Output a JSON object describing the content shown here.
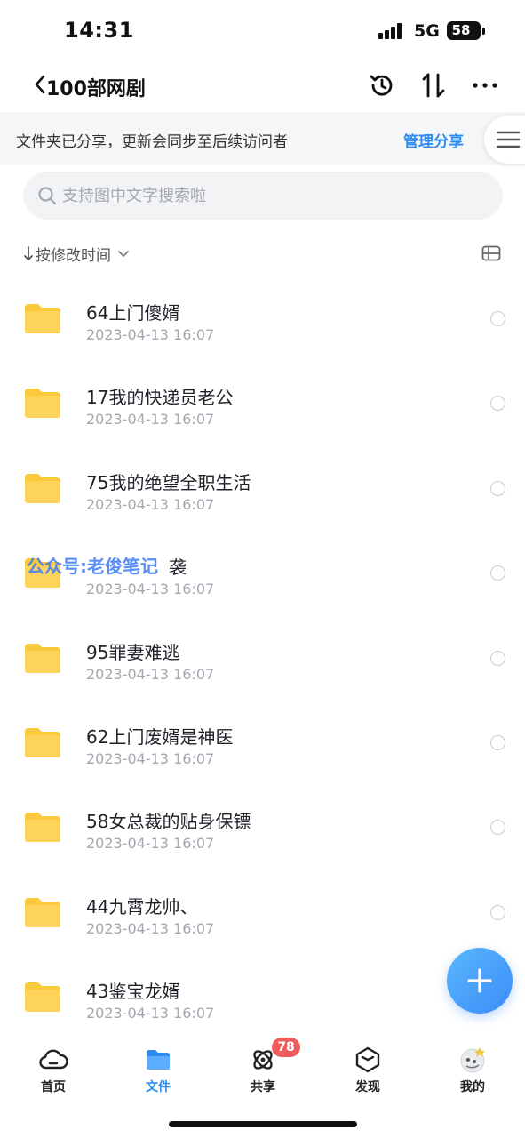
{
  "status_bar": {
    "time": "14:31",
    "network": "5G",
    "battery": "58"
  },
  "header": {
    "title": "100部网剧",
    "icons": [
      "back-icon",
      "history-icon",
      "sort-icon",
      "more-icon"
    ]
  },
  "share_banner": {
    "text": "文件夹已分享，更新会同步至后续访问者",
    "action": "管理分享"
  },
  "search": {
    "placeholder": "支持图中文字搜索啦"
  },
  "sort": {
    "label": "按修改时间"
  },
  "files": [
    {
      "name": "64上门傻婿",
      "date": "2023-04-13 16:07"
    },
    {
      "name": "17我的快递员老公",
      "date": "2023-04-13 16:07"
    },
    {
      "name": "75我的绝望全职生活",
      "date": "2023-04-13 16:07"
    },
    {
      "name": "袭",
      "date": "2023-04-13 16:07"
    },
    {
      "name": "95罪妻难逃",
      "date": "2023-04-13 16:07"
    },
    {
      "name": "62上门废婿是神医",
      "date": "2023-04-13 16:07"
    },
    {
      "name": "58女总裁的贴身保镖",
      "date": "2023-04-13 16:07"
    },
    {
      "name": "44九霄龙帅、",
      "date": "2023-04-13 16:07"
    },
    {
      "name": "43鉴宝龙婿",
      "date": "2023-04-13 16:07"
    }
  ],
  "watermark": "公众号:老俊笔记",
  "tabs": [
    {
      "label": "首页",
      "icon": "cloud-icon"
    },
    {
      "label": "文件",
      "icon": "folder-icon",
      "active": true
    },
    {
      "label": "共享",
      "icon": "share-orbit-icon",
      "badge": "78"
    },
    {
      "label": "发现",
      "icon": "cube-icon"
    },
    {
      "label": "我的",
      "icon": "avatar"
    }
  ],
  "colors": {
    "accent": "#2d8cf0",
    "folder": "#fbc93c",
    "badge": "#f15b5b"
  }
}
